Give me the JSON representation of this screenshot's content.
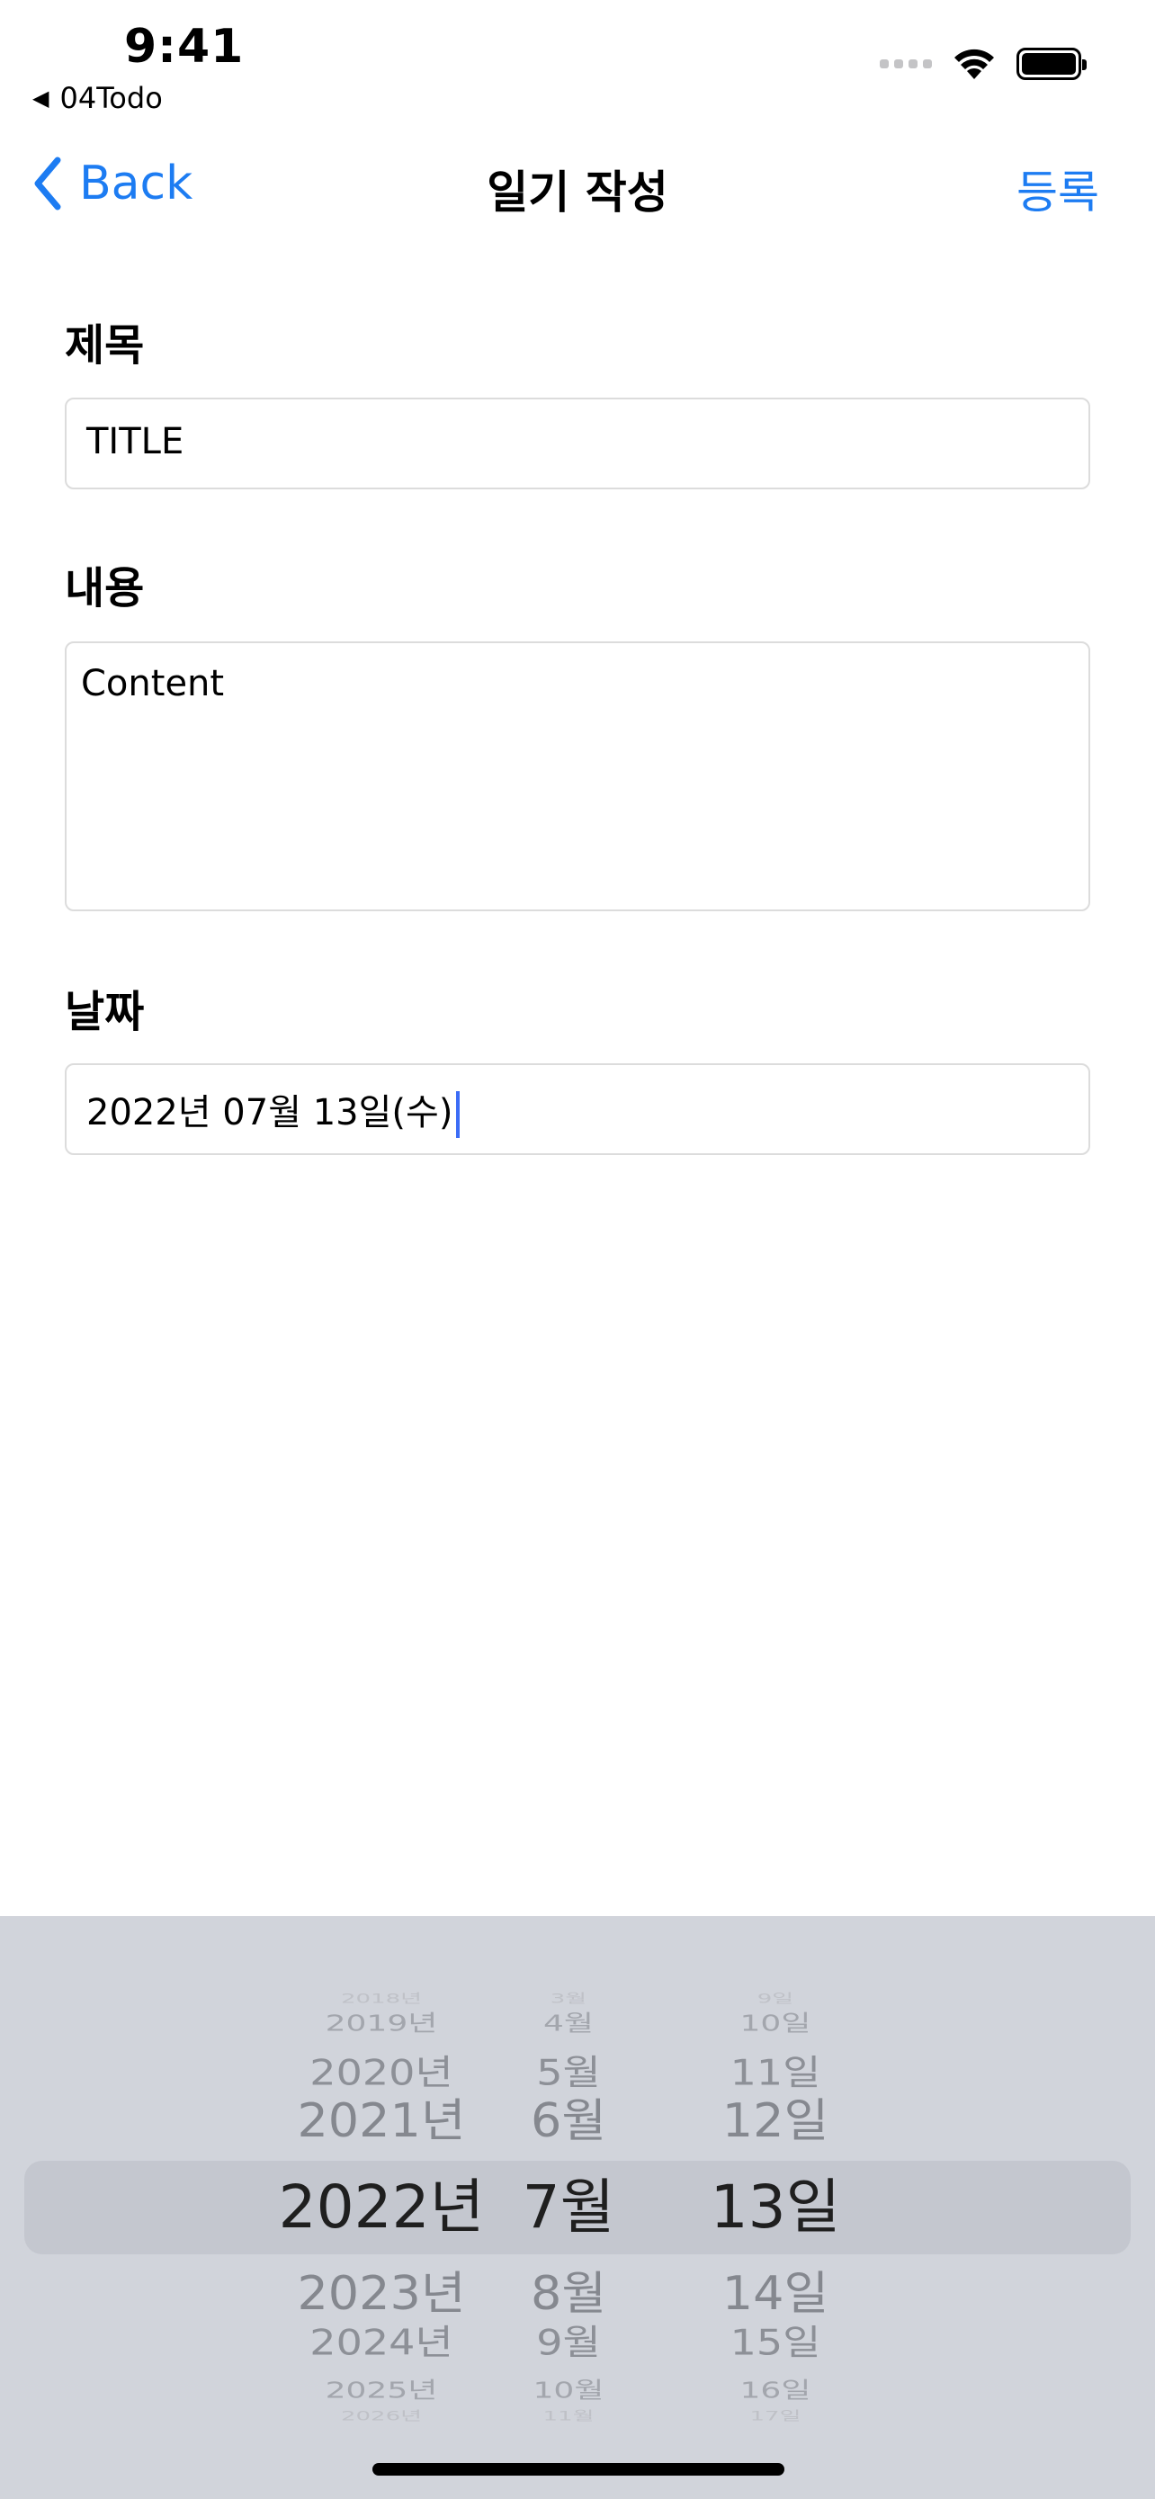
{
  "status_bar": {
    "time": "9:41",
    "back_app": "04Todo"
  },
  "nav": {
    "back_label": "Back",
    "title": "일기 작성",
    "action_label": "등록"
  },
  "form": {
    "title_label": "제목",
    "title_value": "TITLE",
    "content_label": "내용",
    "content_value": "Content",
    "date_label": "날짜",
    "date_value": "2022년 07월 13일(수)"
  },
  "date_picker": {
    "selected": {
      "year": "2022년",
      "month": "7월",
      "day": "13일"
    },
    "rows": [
      {
        "year": "2018년",
        "month": "3월",
        "day": "9일"
      },
      {
        "year": "2019년",
        "month": "4월",
        "day": "10일"
      },
      {
        "year": "2020년",
        "month": "5월",
        "day": "11일"
      },
      {
        "year": "2021년",
        "month": "6월",
        "day": "12일"
      },
      {
        "year": "2022년",
        "month": "7월",
        "day": "13일"
      },
      {
        "year": "2023년",
        "month": "8월",
        "day": "14일"
      },
      {
        "year": "2024년",
        "month": "9월",
        "day": "15일"
      },
      {
        "year": "2025년",
        "month": "10월",
        "day": "16일"
      },
      {
        "year": "2026년",
        "month": "11월",
        "day": "17일"
      }
    ]
  },
  "colors": {
    "accent": "#1d7cf2",
    "picker_bg": "#d1d4db",
    "caret": "#3b6cf6"
  }
}
